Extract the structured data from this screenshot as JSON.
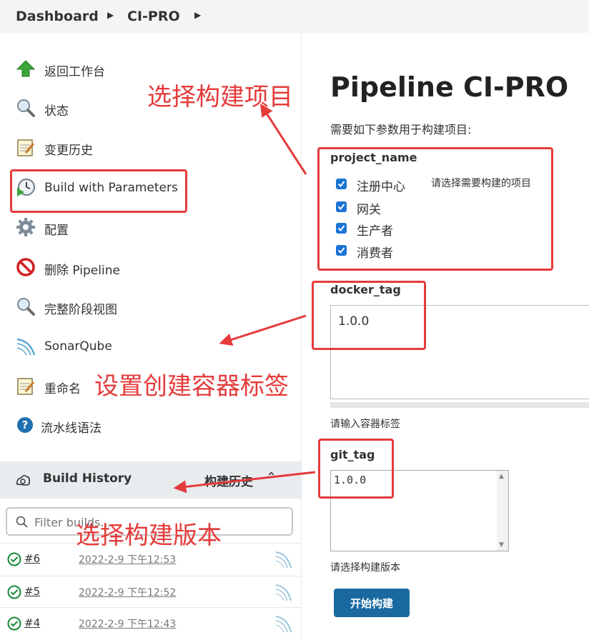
{
  "breadcrumb": {
    "item1": "Dashboard",
    "item2": "CI-PRO"
  },
  "sidebar": {
    "items": [
      {
        "label": "返回工作台",
        "icon": "up-arrow-icon"
      },
      {
        "label": "状态",
        "icon": "magnifier-icon"
      },
      {
        "label": "变更历史",
        "icon": "notepad-icon"
      },
      {
        "label": "Build with Parameters",
        "icon": "clock-play-icon"
      },
      {
        "label": "配置",
        "icon": "gear-icon"
      },
      {
        "label": "删除 Pipeline",
        "icon": "no-entry-icon"
      },
      {
        "label": "完整阶段视图",
        "icon": "magnifier-icon"
      },
      {
        "label": "SonarQube",
        "icon": "sonarqube-icon"
      },
      {
        "label": "重命名",
        "icon": "notepad-icon"
      },
      {
        "label": "流水线语法",
        "icon": "help-icon"
      }
    ]
  },
  "build_history": {
    "title": "Build History",
    "title_cn": "构建历史",
    "filter_placeholder": "Filter builds...",
    "builds": [
      {
        "number": "#6",
        "date": "2022-2-9 下午12:53"
      },
      {
        "number": "#5",
        "date": "2022-2-9 下午12:52"
      },
      {
        "number": "#4",
        "date": "2022-2-9 下午12:43"
      }
    ]
  },
  "main": {
    "title": "Pipeline CI-PRO",
    "description": "需要如下参数用于构建项目:",
    "project_name": {
      "label": "project_name",
      "description": "请选择需要构建的项目",
      "options": [
        "注册中心",
        "网关",
        "生产者",
        "消费者"
      ]
    },
    "docker_tag": {
      "label": "docker_tag",
      "value": "1.0.0",
      "help": "请输入容器标签"
    },
    "git_tag": {
      "label": "git_tag",
      "value": "1.0.0",
      "help": "请选择构建版本"
    },
    "build_button": "开始构建"
  },
  "annotations": {
    "a1": "选择构建项目",
    "a2": "设置创建容器标签",
    "a3": "选择构建版本"
  },
  "colors": {
    "annotation": "#e53b3b",
    "button": "#1a6aa1",
    "checkbox": "#1a73d4",
    "success": "#138a36"
  }
}
